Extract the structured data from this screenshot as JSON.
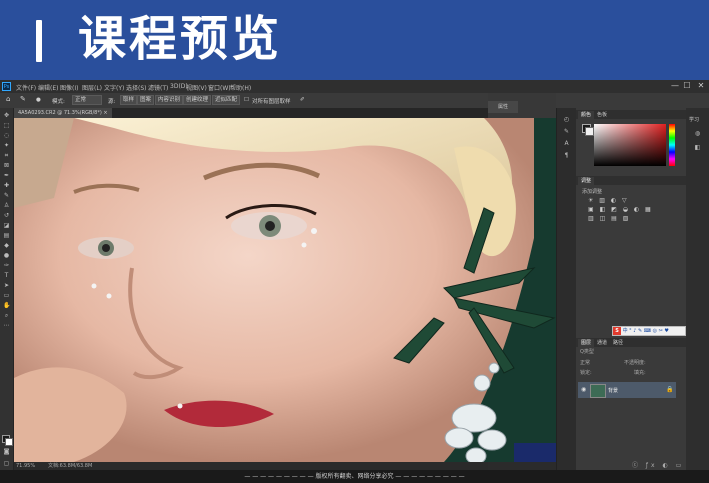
{
  "banner": {
    "title": "课程预览"
  },
  "app": {
    "logo": "Ps",
    "menu": [
      "文件(F)",
      "编辑(E)",
      "图像(I)",
      "图层(L)",
      "文字(Y)",
      "选择(S)",
      "滤镜(T)",
      "3D(D)",
      "视图(V)",
      "窗口(W)",
      "帮助(H)"
    ],
    "window_controls": [
      "—",
      "☐",
      "✕"
    ]
  },
  "options": {
    "mode_label": "模式:",
    "mode_value": "正常",
    "source_label": "源:",
    "sample": "取样",
    "pattern": "图案",
    "content_aware": "内容识别",
    "create_texture": "创建纹理",
    "proximity": "近似匹配",
    "sample_all": "对所有图层取样"
  },
  "document": {
    "tab_label": "4A5A0293.CR2 @ 71.3%(RGB/8*)",
    "close": "×"
  },
  "status": {
    "zoom": "71.95%",
    "doc_info": "文档:63.8M/63.8M"
  },
  "properties_panel": {
    "tab": "属性"
  },
  "color_panel": {
    "tabs": [
      "颜色",
      "色板"
    ]
  },
  "adjustments_panel": {
    "tabs": [
      "调整"
    ],
    "add_label": "添加调整",
    "rows": [
      "☀ ▥ ◐ ▽",
      "▣ ◧ ◩ ◒ ◐ ▦",
      "▥ ◫ ▤ ▧"
    ]
  },
  "ime_toolbar": {
    "logo": "S",
    "text": "中 ° ♪ ✎ ⌨ ◎ ✂ ♥"
  },
  "layers_panel": {
    "tabs": [
      "图层",
      "通道",
      "路径"
    ],
    "kind_label": "Q类型",
    "blend_mode": "正常",
    "opacity_label": "不透明度:",
    "lock_label": "锁定:",
    "fill_label": "填充:",
    "layer_name": "背景",
    "bottom_icons": "ⓒ ƒx ◐ ▭ ▢ ⊞ 🗑"
  },
  "right_strip": {
    "label": "学习"
  },
  "footer": {
    "text": "— — — — — — — — — 版权所有翻卖、网络分享必究 — — — — — — — — —"
  },
  "colors": {
    "banner": "#2a4f9c",
    "app_bg": "#2b2b2b",
    "accent": "#31a8ff"
  }
}
